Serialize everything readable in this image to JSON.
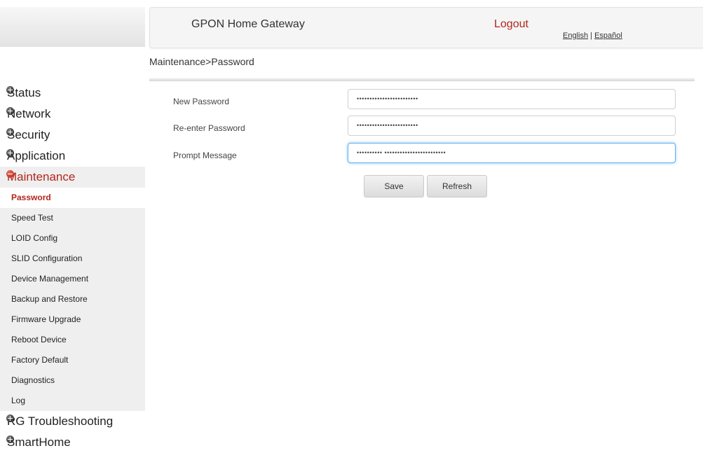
{
  "header": {
    "title": "GPON Home Gateway",
    "logout": "Logout",
    "lang_english": "English",
    "lang_separator": " | ",
    "lang_espanol": "Español"
  },
  "breadcrumb": "Maintenance>Password",
  "sidebar": {
    "sections": [
      {
        "label": "Status"
      },
      {
        "label": "Network"
      },
      {
        "label": "Security"
      },
      {
        "label": "Application"
      },
      {
        "label": "Maintenance"
      }
    ],
    "maintenance_items": [
      {
        "label": "Password"
      },
      {
        "label": "Speed Test"
      },
      {
        "label": "LOID Config"
      },
      {
        "label": "SLID Configuration"
      },
      {
        "label": "Device Management"
      },
      {
        "label": "Backup and Restore"
      },
      {
        "label": "Firmware Upgrade"
      },
      {
        "label": "Reboot Device"
      },
      {
        "label": "Factory Default"
      },
      {
        "label": "Diagnostics"
      },
      {
        "label": "Log"
      }
    ],
    "bottom_sections": [
      {
        "label": "RG Troubleshooting"
      },
      {
        "label": "SmartHome"
      }
    ]
  },
  "form": {
    "new_password_label": "New Password",
    "new_password_value": "••••••••••••••••••••••••",
    "reenter_password_label": "Re-enter Password",
    "reenter_password_value": "••••••••••••••••••••••••",
    "prompt_message_label": "Prompt Message",
    "prompt_message_value": "•••••••••• ••••••••••••••••••••••••",
    "save_label": "Save",
    "refresh_label": "Refresh"
  },
  "colors": {
    "accent": "#b2261d",
    "focus": "#66afe9"
  }
}
